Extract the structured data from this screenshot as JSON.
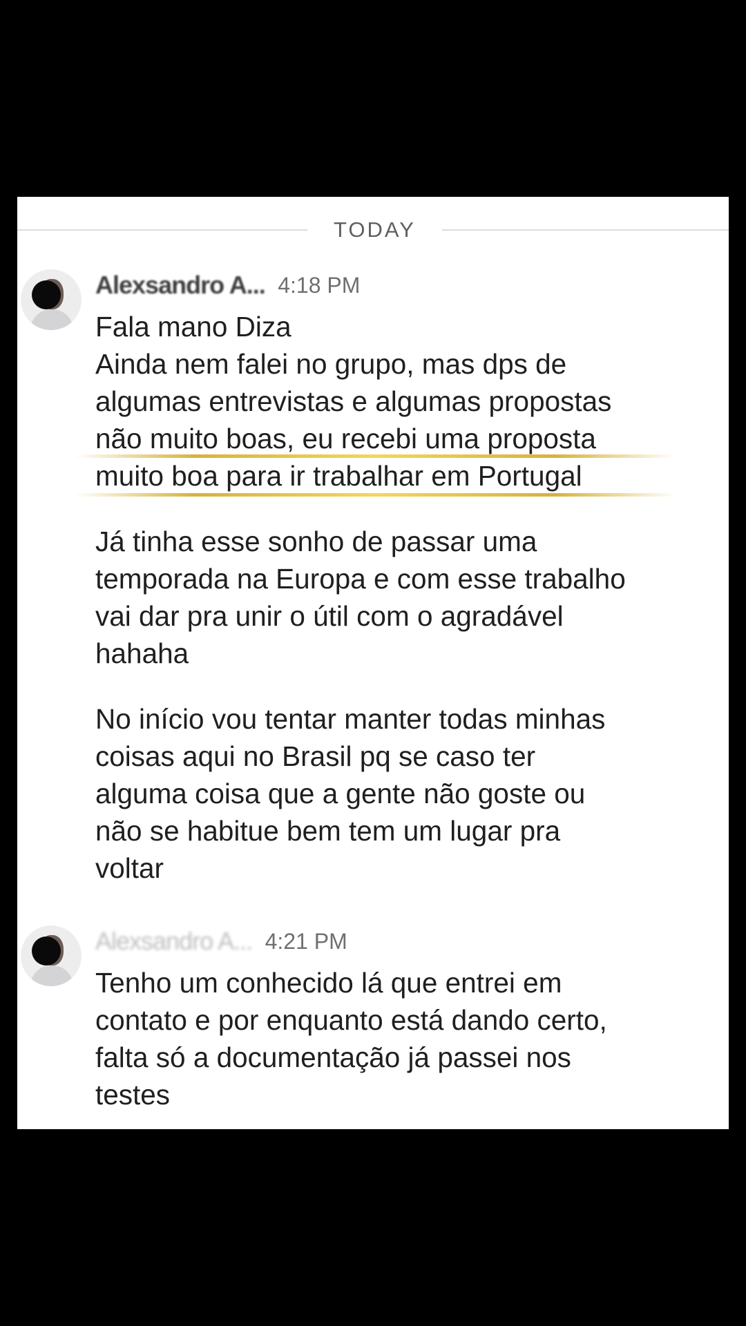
{
  "divider": {
    "label": "TODAY"
  },
  "messages": [
    {
      "sender": "Alexsandro A...",
      "time": "4:18 PM",
      "paragraphs": [
        {
          "lines": [
            "Fala mano Diza",
            "Ainda nem falei no grupo, mas dps de",
            "algumas entrevistas e algumas propostas",
            "não muito boas, eu recebi uma proposta",
            "muito boa para ir trabalhar em Portugal"
          ]
        },
        {
          "lines": [
            "Já tinha esse sonho de passar uma",
            "temporada na Europa e com esse trabalho",
            "vai dar pra unir o útil com o agradável",
            "hahaha"
          ]
        },
        {
          "lines": [
            "No início vou tentar manter todas minhas",
            "coisas aqui no Brasil pq se caso ter",
            "alguma coisa que a gente não goste ou",
            "não se habitue bem tem um lugar pra",
            "voltar"
          ]
        }
      ]
    },
    {
      "sender": "Alexsandro A...",
      "time": "4:21 PM",
      "paragraphs": [
        {
          "lines": [
            "Tenho um conhecido lá que entrei em",
            "contato e por enquanto está dando certo,",
            "falta só a documentação já passei nos",
            "testes"
          ]
        }
      ]
    }
  ],
  "colors": {
    "background": "#000000",
    "card": "#ffffff",
    "text": "#1f1f1f",
    "timestamp": "#6f6f6f",
    "highlight": "#f3d75b"
  }
}
